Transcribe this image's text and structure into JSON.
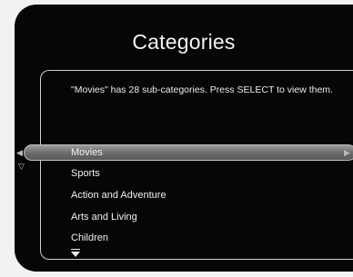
{
  "screen": {
    "title": "Categories"
  },
  "info": {
    "text": "\"Movies\" has 28 sub-categories. Press SELECT to view them."
  },
  "menu": {
    "selected_index": 0,
    "items": [
      {
        "label": "Movies"
      },
      {
        "label": "Sports"
      },
      {
        "label": "Action and Adventure"
      },
      {
        "label": "Arts and Living"
      },
      {
        "label": "Children"
      }
    ]
  },
  "icons": {
    "left": "chevron-left-icon",
    "right": "chevron-right-icon",
    "up": "chevron-up-icon",
    "down": "chevron-down-icon"
  }
}
